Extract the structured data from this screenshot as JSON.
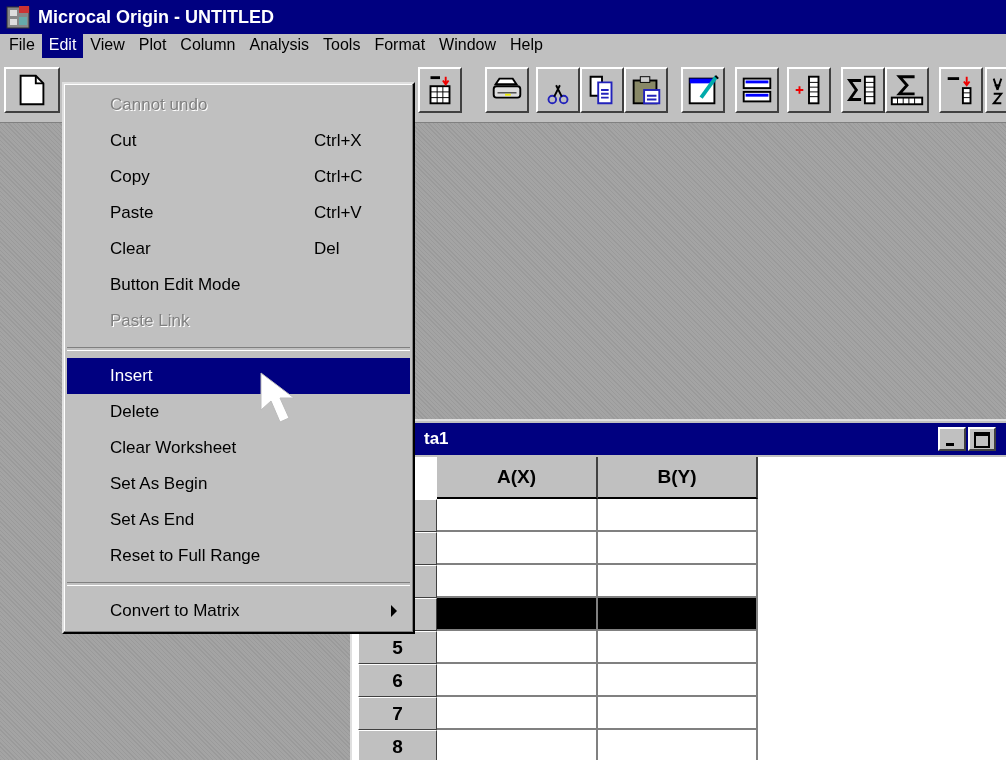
{
  "window": {
    "title": "Microcal Origin - UNTITLED"
  },
  "menu_bar": [
    {
      "label": "File",
      "selected": false
    },
    {
      "label": "Edit",
      "selected": true
    },
    {
      "label": "View",
      "selected": false
    },
    {
      "label": "Plot",
      "selected": false
    },
    {
      "label": "Column",
      "selected": false
    },
    {
      "label": "Analysis",
      "selected": false
    },
    {
      "label": "Tools",
      "selected": false
    },
    {
      "label": "Format",
      "selected": false
    },
    {
      "label": "Window",
      "selected": false
    },
    {
      "label": "Help",
      "selected": false
    }
  ],
  "edit_menu": [
    {
      "kind": "item",
      "label": "Cannot undo",
      "disabled": true,
      "selected": false
    },
    {
      "kind": "item",
      "label": "Cut",
      "shortcut": "Ctrl+X",
      "disabled": false,
      "selected": false
    },
    {
      "kind": "item",
      "label": "Copy",
      "shortcut": "Ctrl+C",
      "disabled": false,
      "selected": false
    },
    {
      "kind": "item",
      "label": "Paste",
      "shortcut": "Ctrl+V",
      "disabled": false,
      "selected": false
    },
    {
      "kind": "item",
      "label": "Clear",
      "shortcut": "Del",
      "disabled": false,
      "selected": false
    },
    {
      "kind": "item",
      "label": "Button Edit Mode",
      "disabled": false,
      "selected": false
    },
    {
      "kind": "item",
      "label": "Paste Link",
      "disabled": true,
      "selected": false
    },
    {
      "kind": "separator"
    },
    {
      "kind": "item",
      "label": "Insert",
      "disabled": false,
      "selected": true
    },
    {
      "kind": "item",
      "label": "Delete",
      "disabled": false,
      "selected": false
    },
    {
      "kind": "item",
      "label": "Clear Worksheet",
      "disabled": false,
      "selected": false
    },
    {
      "kind": "item",
      "label": "Set As Begin",
      "disabled": false,
      "selected": false
    },
    {
      "kind": "item",
      "label": "Set As End",
      "disabled": false,
      "selected": false
    },
    {
      "kind": "item",
      "label": "Reset to Full Range",
      "disabled": false,
      "selected": false
    },
    {
      "kind": "separator"
    },
    {
      "kind": "submenu",
      "label": "Convert to Matrix",
      "disabled": false,
      "selected": false
    }
  ],
  "worksheet": {
    "title": "ta1",
    "columns": [
      "A(X)",
      "B(Y)"
    ],
    "rows": [
      {
        "selected": false
      },
      {
        "selected": false
      },
      {
        "selected": false
      },
      {
        "selected": true
      },
      {
        "label": "5",
        "selected": false
      },
      {
        "label": "6",
        "selected": false
      },
      {
        "label": "7",
        "selected": false
      },
      {
        "label": "8",
        "selected": false
      }
    ]
  }
}
